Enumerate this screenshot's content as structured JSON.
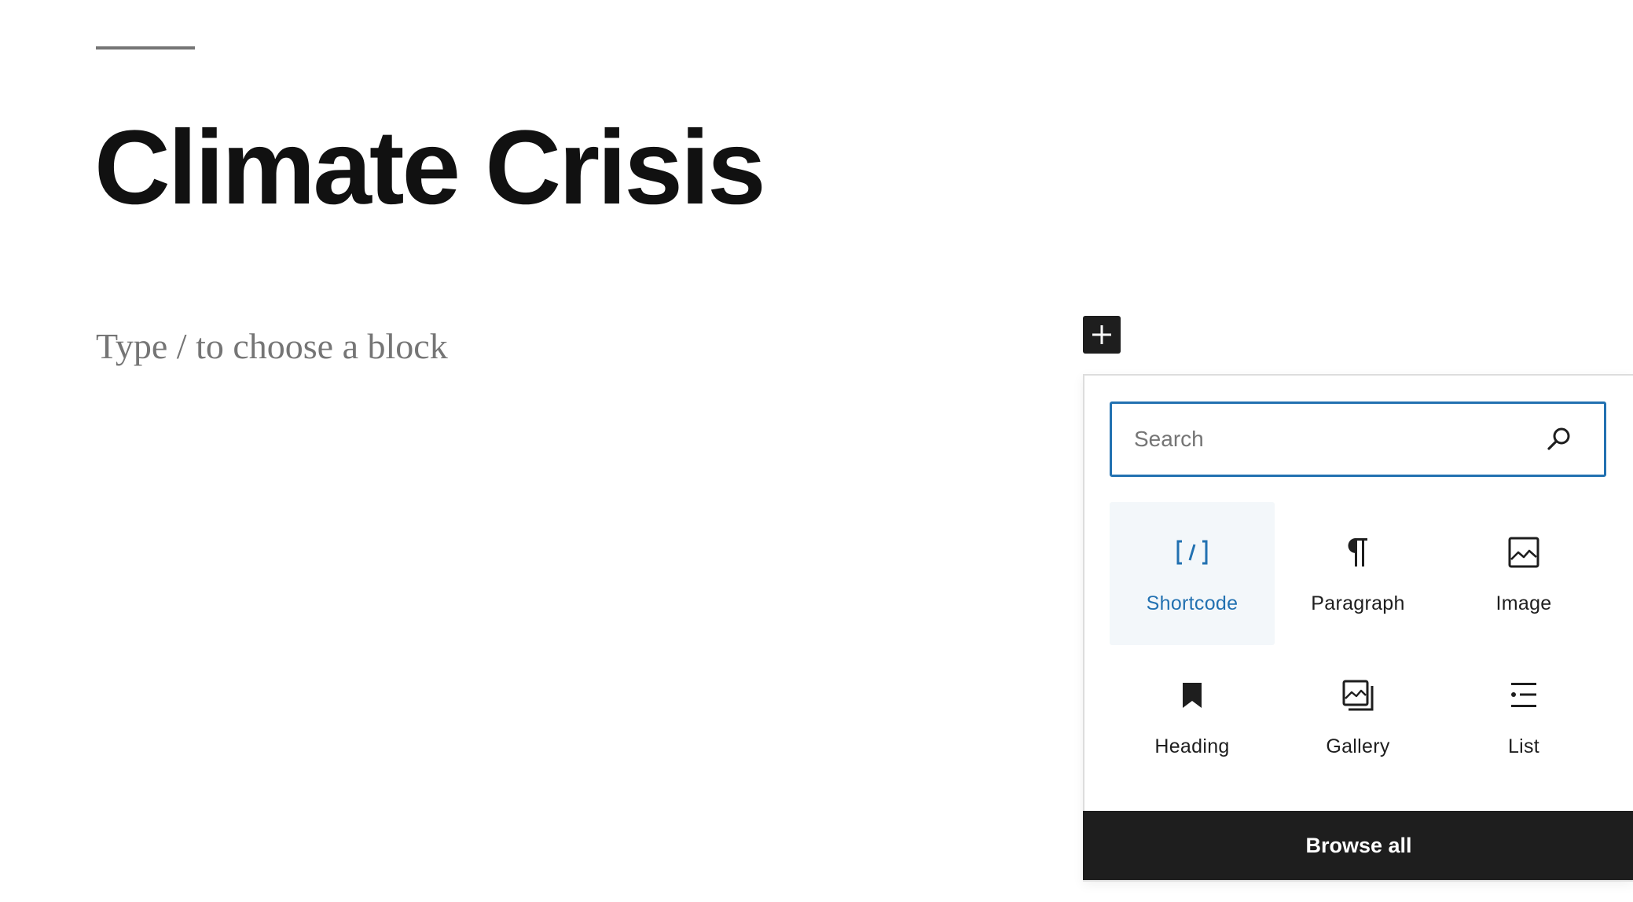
{
  "editor": {
    "title": "Climate Crisis",
    "block_placeholder": "Type / to choose a block"
  },
  "inserter": {
    "toggle_icon": "plus-icon",
    "search": {
      "placeholder": "Search",
      "value": "",
      "icon": "search-icon"
    },
    "blocks": [
      {
        "label": "Shortcode",
        "icon": "shortcode-icon",
        "selected": true
      },
      {
        "label": "Paragraph",
        "icon": "paragraph-icon",
        "selected": false
      },
      {
        "label": "Image",
        "icon": "image-icon",
        "selected": false
      },
      {
        "label": "Heading",
        "icon": "heading-icon",
        "selected": false
      },
      {
        "label": "Gallery",
        "icon": "gallery-icon",
        "selected": false
      },
      {
        "label": "List",
        "icon": "list-icon",
        "selected": false
      }
    ],
    "browse_all_label": "Browse all"
  },
  "colors": {
    "accent": "#2271b1",
    "dark": "#1e1e1e",
    "muted_text": "#757575",
    "selected_bg": "#f3f7fa"
  }
}
